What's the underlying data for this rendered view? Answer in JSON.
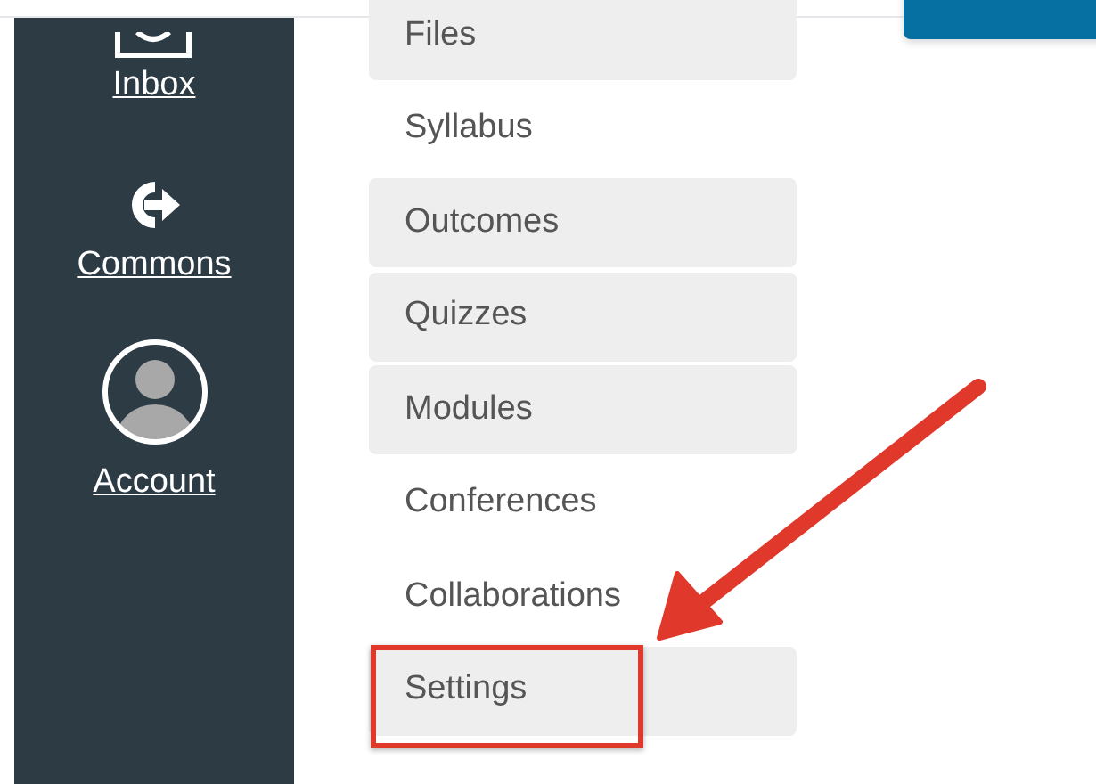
{
  "global_nav": [
    {
      "kind": "inbox",
      "label": "Inbox"
    },
    {
      "kind": "commons",
      "label": "Commons"
    },
    {
      "kind": "account",
      "label": "Account"
    }
  ],
  "course_nav": [
    {
      "label": "Files",
      "greyed": true,
      "highlighted": false
    },
    {
      "label": "Syllabus",
      "greyed": false,
      "highlighted": false
    },
    {
      "label": "Outcomes",
      "greyed": true,
      "highlighted": false
    },
    {
      "label": "Quizzes",
      "greyed": true,
      "highlighted": false
    },
    {
      "label": "Modules",
      "greyed": true,
      "highlighted": false
    },
    {
      "label": "Conferences",
      "greyed": false,
      "highlighted": false
    },
    {
      "label": "Collaborations",
      "greyed": false,
      "highlighted": false
    },
    {
      "label": "Settings",
      "greyed": true,
      "highlighted": true
    }
  ]
}
